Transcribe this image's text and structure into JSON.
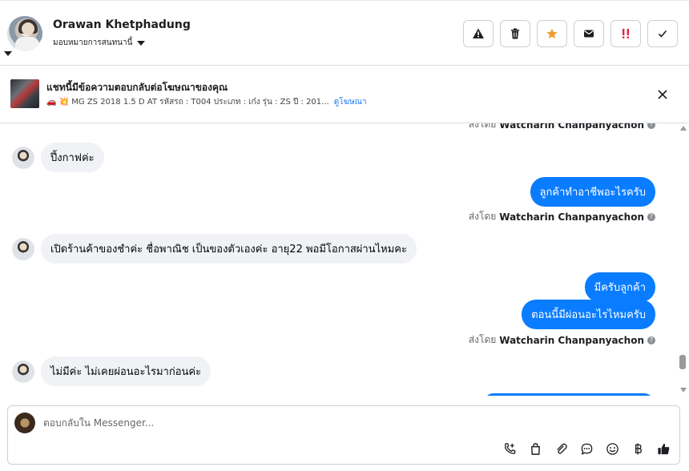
{
  "header": {
    "contact_name": "Orawan Khetphadung",
    "assign_label": "มอบหมายการสนทนานี้"
  },
  "actions": [
    {
      "name": "report-button",
      "icon": "warning-icon"
    },
    {
      "name": "delete-button",
      "icon": "trash-icon"
    },
    {
      "name": "star-button",
      "icon": "star-icon"
    },
    {
      "name": "mark-unread-button",
      "icon": "envelope-icon"
    },
    {
      "name": "spam-button",
      "icon": "exclamation-icon"
    },
    {
      "name": "done-button",
      "icon": "check-icon"
    }
  ],
  "colors": {
    "accent": "#0a7cff",
    "star": "#f2992e",
    "spam": "#e41e3f"
  },
  "ad": {
    "title": "แชทนี้มีข้อความตอบกลับต่อโฆษณาของคุณ",
    "subtitle": "🚗 💥 MG ZS 2018 1.5 D AT รหัสรถ : T004 ประเภท : เก๋ง รุ่น : ZS ปี : 201...",
    "link": "ดูโฆษณา"
  },
  "messages": {
    "sent_by_prefix": "ส่งโดย",
    "sender": "Watcharin Chanpanyachon",
    "top_partial_sender": "Watcharin Chanpanyachon",
    "in1": "ปึ้งกาฟค่ะ",
    "out1": "ลูกค้าทำอาชีพอะไรครับ",
    "in2": "เปิดร้านค้าของชำค่ะ ชื่อพาณิช เป็นของตัวเองค่ะ อายุ22 พอมีโอกาสผ่านไหมคะ",
    "out2a": "มีครับลูกค้า",
    "out2b": "ตอนนี้มีผ่อนอะไรไหมครับ",
    "in3": "ไม่มีค่ะ ไม่เคยผ่อนอะไรมาก่อนค่ะ"
  },
  "composer": {
    "placeholder": "ตอบกลับใน Messenger..."
  }
}
